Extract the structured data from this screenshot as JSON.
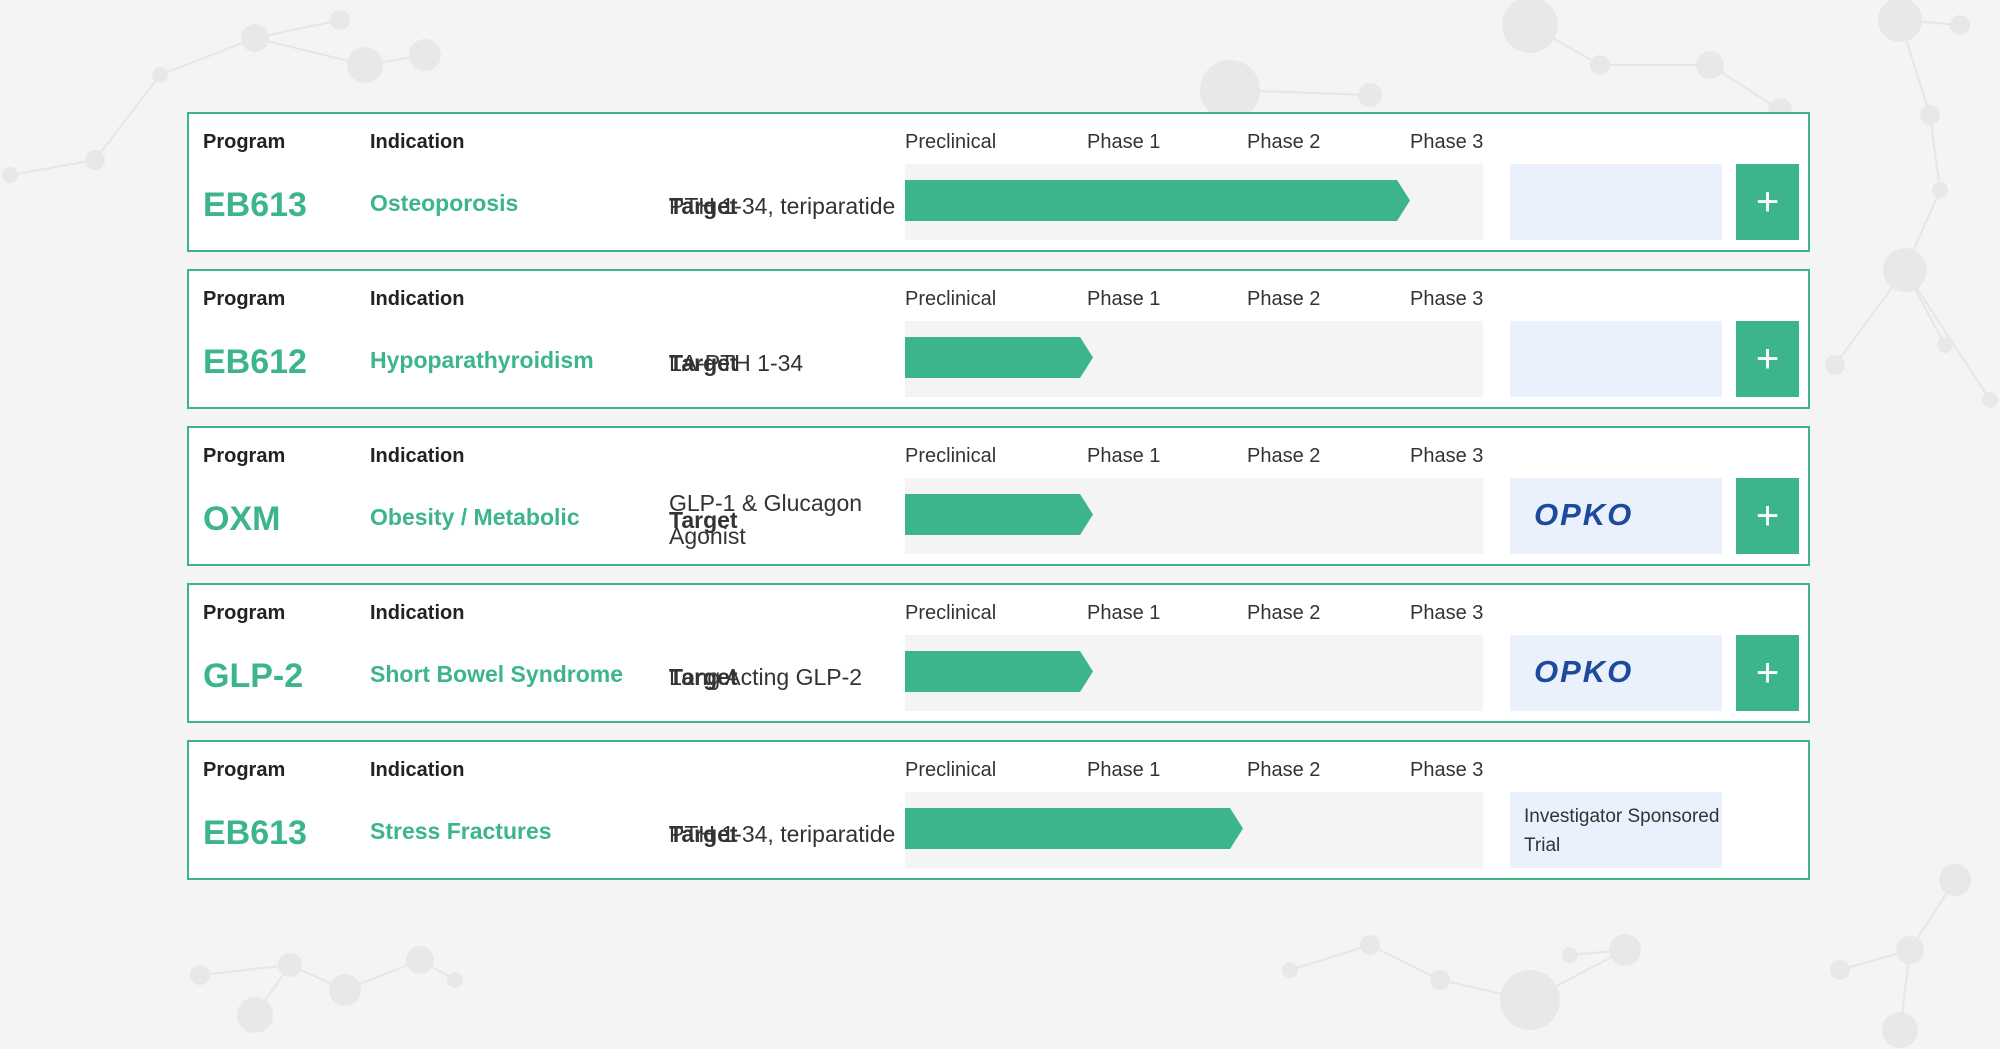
{
  "headers": {
    "program": "Program",
    "indication": "Indication",
    "target": "Target",
    "phases": [
      "Preclinical",
      "Phase 1",
      "Phase 2",
      "Phase 3"
    ]
  },
  "rows": [
    {
      "program": "EB613",
      "indication": "Osteoporosis",
      "target": "PTH 1-34, teriparatide",
      "progress_fraction": 0.873,
      "partner_type": "empty",
      "partner_text": "",
      "has_plus": true
    },
    {
      "program": "EB612",
      "indication": "Hypoparathyroidism",
      "target": "LA-PTH 1-34",
      "progress_fraction": 0.325,
      "partner_type": "empty",
      "partner_text": "",
      "has_plus": true
    },
    {
      "program": "OXM",
      "indication": "Obesity / Metabolic",
      "target": "GLP-1 & Glucagon Agonist",
      "progress_fraction": 0.325,
      "partner_type": "logo",
      "partner_text": "OPKO",
      "has_plus": true
    },
    {
      "program": "GLP-2",
      "indication": "Short Bowel Syndrome",
      "target": "Long Acting GLP-2",
      "progress_fraction": 0.325,
      "partner_type": "logo",
      "partner_text": "OPKO",
      "has_plus": true
    },
    {
      "program": "EB613",
      "indication": "Stress Fractures",
      "target": "PTH 1-34, teriparatide",
      "progress_fraction": 0.585,
      "partner_type": "text",
      "partner_text": "Investigator Sponsored Trial",
      "has_plus": false
    }
  ],
  "plus_label": "+",
  "colors": {
    "accent": "#3db58a",
    "partner_bg": "#eaf1fd",
    "logo": "#1d4a9c",
    "track": "#f4f4f4"
  }
}
